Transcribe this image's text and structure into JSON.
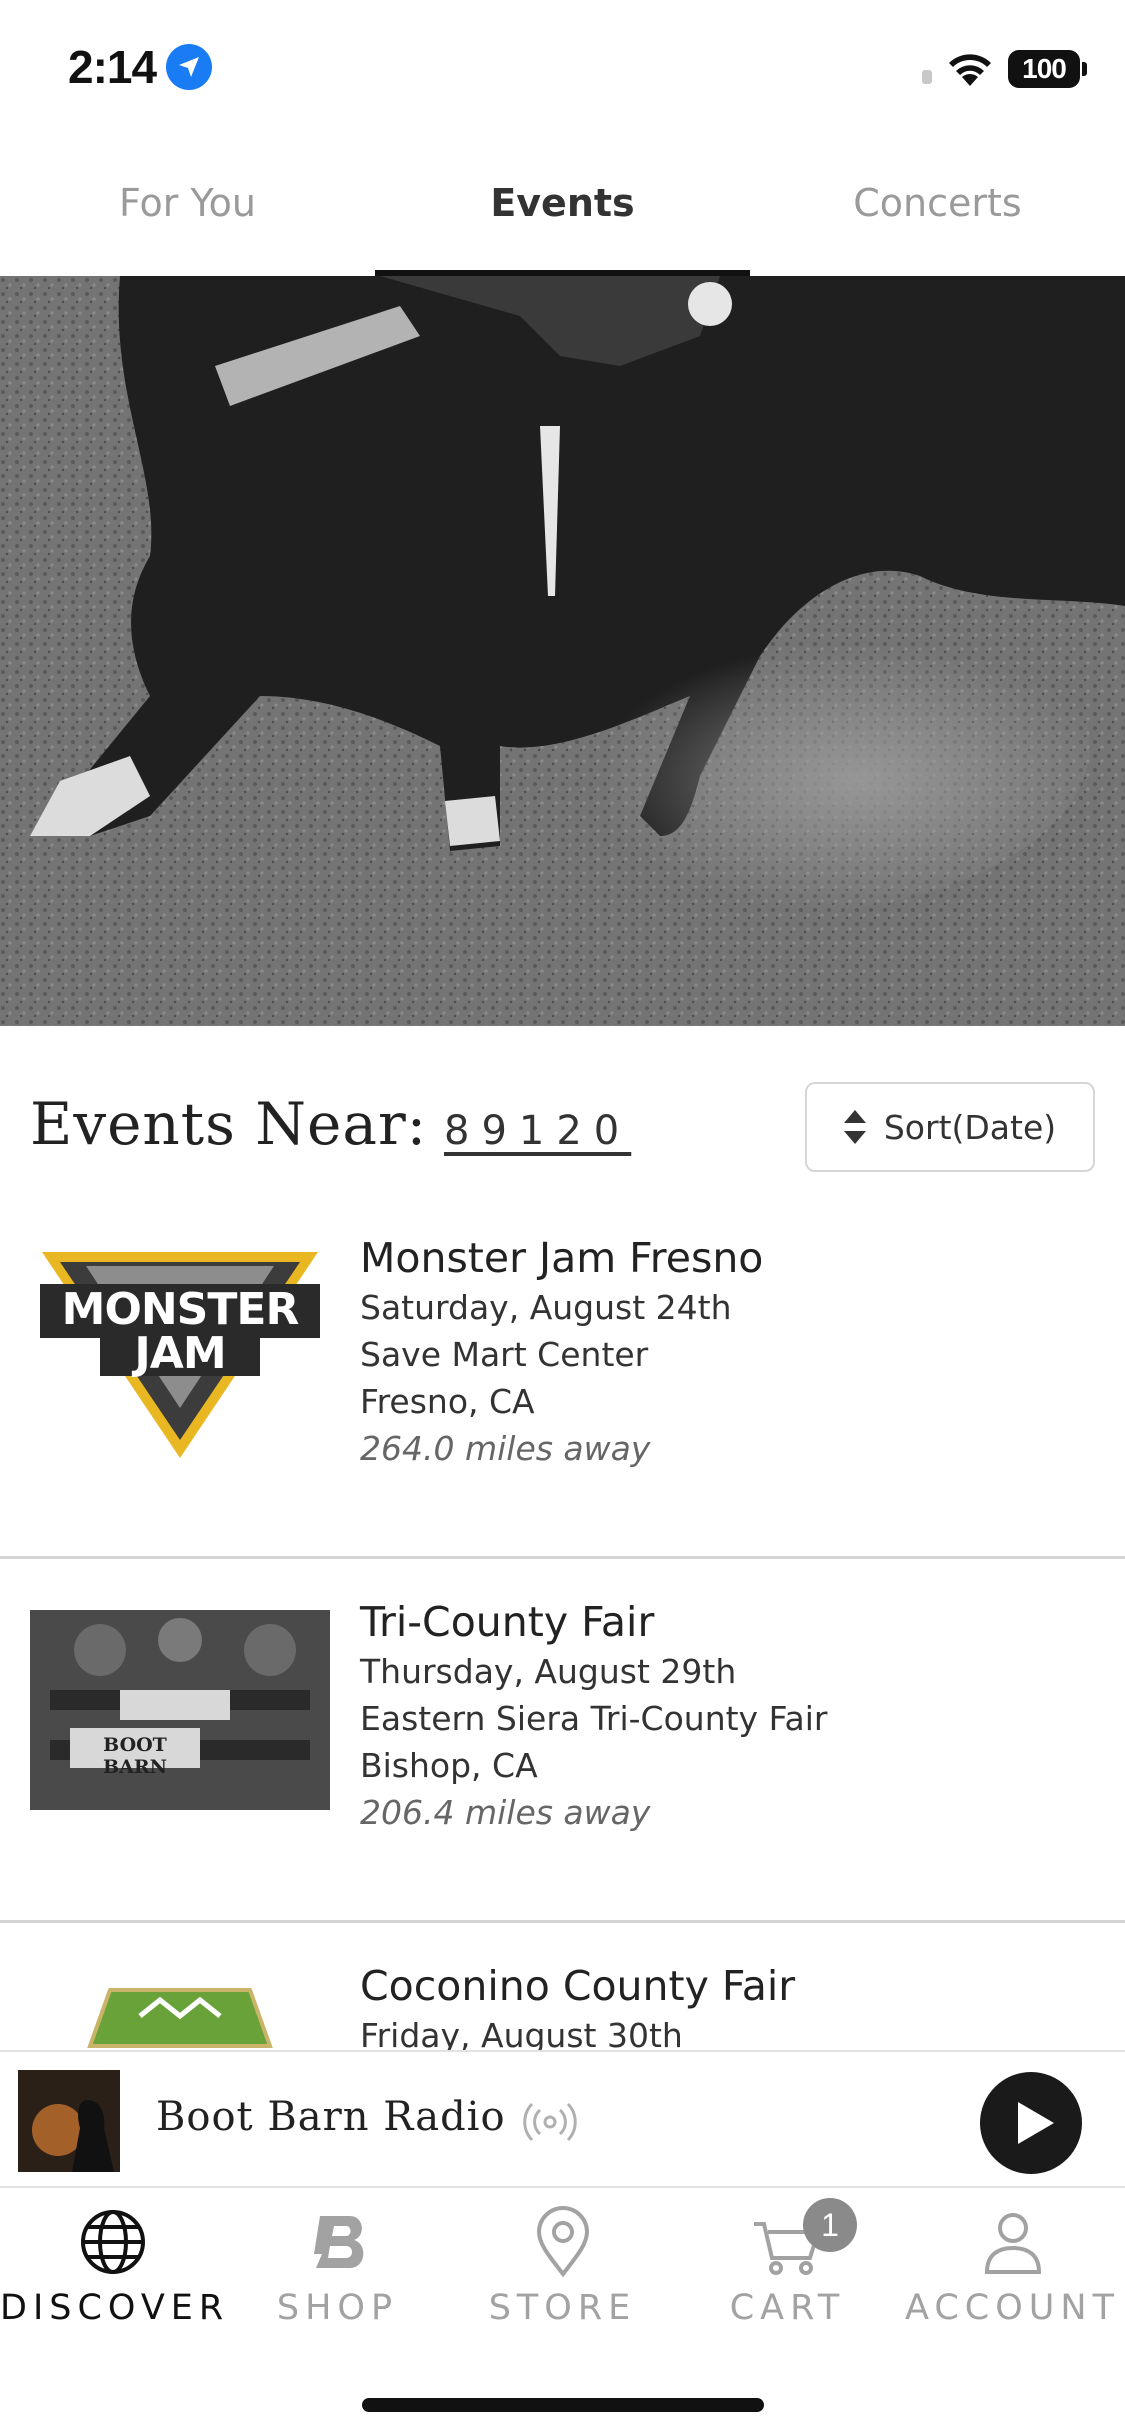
{
  "status_bar": {
    "time": "2:14",
    "battery": "100"
  },
  "tabs": [
    {
      "label": "For You"
    },
    {
      "label": "Events",
      "active": true
    },
    {
      "label": "Concerts"
    }
  ],
  "events_header": {
    "label": "Events Near:",
    "zip": "89120",
    "sort_label": "Sort(Date)"
  },
  "events": [
    {
      "title": "Monster Jam Fresno",
      "date": "Saturday, August 24th",
      "venue": "Save Mart Center",
      "location": "Fresno, CA",
      "distance": "264.0 miles away",
      "logo_text": "MONSTER JAM"
    },
    {
      "title": "Tri-County Fair",
      "date": "Thursday, August 29th",
      "venue": "Eastern Siera Tri-County Fair",
      "location": "Bishop, CA",
      "distance": "206.4 miles away",
      "logo_text": "BOOT BARN"
    },
    {
      "title": "Coconino County Fair",
      "date": "Friday, August 30th"
    }
  ],
  "radio": {
    "title": "Boot Barn Radio"
  },
  "bottom_nav": [
    {
      "label": "DISCOVER",
      "icon": "globe-icon",
      "active": true
    },
    {
      "label": "SHOP",
      "icon": "boot-barn-b-icon"
    },
    {
      "label": "STORE",
      "icon": "map-pin-icon"
    },
    {
      "label": "CART",
      "icon": "cart-icon",
      "badge": "1"
    },
    {
      "label": "ACCOUNT",
      "icon": "person-icon"
    }
  ],
  "colors": {
    "accent_blue": "#1a7cf5",
    "active_text": "#111111",
    "inactive_text": "#a2a2a2",
    "monster_jam_gold": "#e8b722",
    "fair_green": "#6aa23a"
  }
}
